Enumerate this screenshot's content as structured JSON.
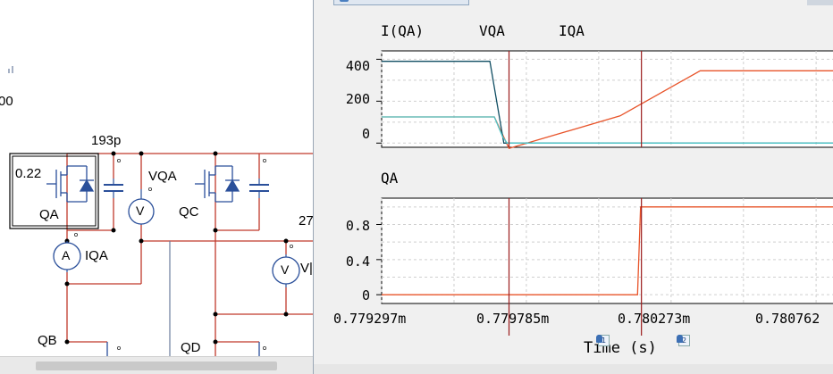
{
  "schematic": {
    "partial_labels": {
      "top_left": "00",
      "mid_right": "27",
      "far_right": "V|"
    },
    "capacitor_value": "193p",
    "switch_qa": {
      "name": "QA",
      "value": "0.22"
    },
    "switch_qc": {
      "name": "QC"
    },
    "switch_qb": {
      "name": "QB"
    },
    "switch_qd": {
      "name": "QD"
    },
    "voltmeter_vqa": {
      "name": "VQA",
      "symbol": "V"
    },
    "ammeter_iqa": {
      "name": "IQA",
      "symbol": "A"
    },
    "voltmeter_right": {
      "symbol": "V"
    }
  },
  "scope": {
    "colors": {
      "iqa_current": "#e8542a",
      "vqa": "#0f4d62",
      "iqa": "#4fc6c8",
      "qa": "#e8542a",
      "cursor": "#9b1c1c",
      "plot_bg": "#ffffff",
      "grid": "#cfcfcf"
    },
    "top_plot": {
      "legend": [
        "I(QA)",
        "VQA",
        "IQA"
      ],
      "y_ticks": [
        "400",
        "200",
        "0"
      ]
    },
    "bottom_plot": {
      "legend": [
        "QA"
      ],
      "y_ticks": [
        "0.8",
        "0.4",
        "0"
      ]
    },
    "x_ticks": [
      "0.779297m",
      "0.779785m",
      "0.780273m",
      "0.780762"
    ],
    "x_label": "Time (s)",
    "cursors": [
      {
        "label": "1"
      },
      {
        "label": "2"
      }
    ]
  },
  "chart_data": [
    {
      "type": "line",
      "title": "",
      "xlabel": "Time (s)",
      "ylabel": "",
      "x_ticks": [
        "0.779297m",
        "0.779785m",
        "0.780273m",
        "0.780762"
      ],
      "ylim": [
        -20,
        440
      ],
      "series": [
        {
          "name": "I(QA)",
          "points": [
            [
              0.779297,
              125
            ],
            [
              0.779677,
              125
            ],
            [
              0.7797265,
              -25
            ],
            [
              0.780101,
              130
            ],
            [
              0.780371,
              345
            ],
            [
              0.780822,
              345
            ]
          ]
        },
        {
          "name": "VQA",
          "points": [
            [
              0.779297,
              390
            ],
            [
              0.779662,
              390
            ],
            [
              0.779709,
              0
            ],
            [
              0.780822,
              0
            ]
          ]
        },
        {
          "name": "IQA",
          "points": [
            [
              0.779297,
              125
            ],
            [
              0.779677,
              125
            ],
            [
              0.779705,
              30
            ],
            [
              0.77972,
              0
            ],
            [
              0.780822,
              0
            ]
          ]
        }
      ]
    },
    {
      "type": "line",
      "title": "",
      "xlabel": "Time (s)",
      "ylabel": "",
      "ylim": [
        -0.1,
        1.1
      ],
      "series": [
        {
          "name": "QA",
          "points": [
            [
              0.779297,
              0
            ],
            [
              0.78016,
              0
            ],
            [
              0.78017,
              1
            ],
            [
              0.780822,
              1
            ]
          ]
        }
      ]
    }
  ]
}
